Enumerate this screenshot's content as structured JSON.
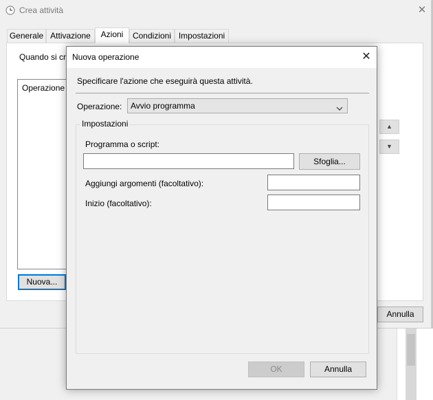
{
  "main_window": {
    "title": "Crea attività",
    "close_glyph": "✕",
    "tabs": [
      {
        "label": "Generale"
      },
      {
        "label": "Attivazione"
      },
      {
        "label": "Azioni"
      },
      {
        "label": "Condizioni"
      },
      {
        "label": "Impostazioni"
      }
    ],
    "active_tab": "Azioni",
    "intro_text": "Quando si cr",
    "list_column": "Operazione",
    "new_button": "Nuova...",
    "move_up_glyph": "▲",
    "move_down_glyph": "▼",
    "cancel_button": "Annulla"
  },
  "dialog": {
    "title": "Nuova operazione",
    "close_glyph": "✕",
    "instruction": "Specificare l'azione che eseguirà questa attività.",
    "operation_label": "Operazione:",
    "operation_value": "Avvio programma",
    "group_legend": "Impostazioni",
    "program_label": "Programma o script:",
    "program_value": "",
    "browse_button": "Sfoglia...",
    "arguments_label": "Aggiungi argomenti (facoltativo):",
    "arguments_value": "",
    "start_label": "Inizio (facoltativo):",
    "start_value": "",
    "ok_button": "OK",
    "ok_enabled": false,
    "cancel_button": "Annulla"
  },
  "icons": {
    "title_icon": "clock-icon",
    "select_icon": "chevron-down-icon"
  },
  "colors": {
    "focus_border": "#0078d7",
    "window_bg": "#f0f0f0"
  }
}
